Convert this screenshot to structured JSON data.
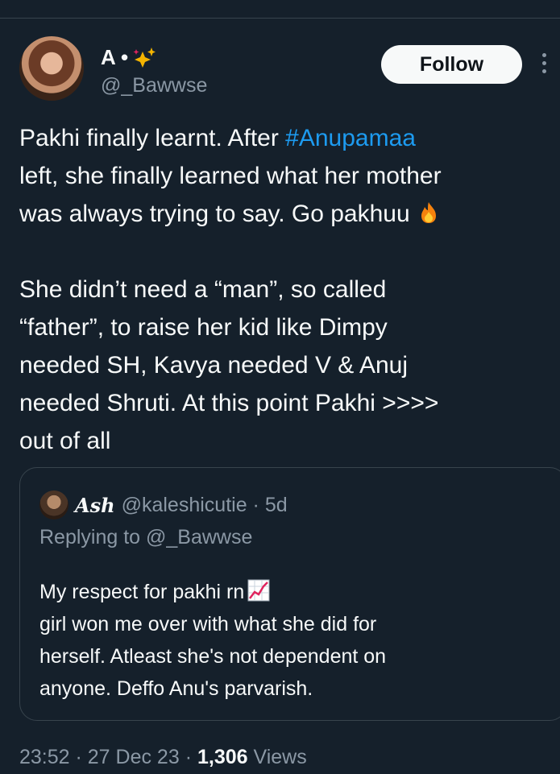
{
  "author": {
    "display_name": "A •",
    "handle": "@_Bawwse"
  },
  "follow_label": "Follow",
  "tweet": {
    "line1_before": "Pakhi finally learnt. After ",
    "hashtag": "#Anupamaa",
    "line2": "left, she finally learned what her mother",
    "line3": "was always trying to say. Go pakhuu ",
    "para2_l1": "She didn’t need a “man”, so called",
    "para2_l2": "“father”, to raise her kid like Dimpy",
    "para2_l3": "needed SH, Kavya needed V & Anuj",
    "para2_l4": "needed Shruti. At this point Pakhi >>>>",
    "para2_l5": "out of all"
  },
  "quote": {
    "name": "Ash",
    "handle_time": "@kaleshicutie · 5d",
    "replying_to": "Replying to @_Bawwse",
    "l1": "My respect for pakhi rn",
    "l2": "girl won me over with what she did for",
    "l3": "herself. Atleast she's not dependent on",
    "l4": "anyone. Deffo Anu's parvarish."
  },
  "meta": {
    "time_date": "23:52 · 27 Dec 23 · ",
    "views_count": "1,306",
    "views_label": " Views"
  },
  "icons": [
    "sparkles-icon",
    "fire-icon",
    "chart-increasing-icon",
    "more-options-icon"
  ],
  "colors": {
    "background": "#15202b",
    "link": "#1d9bf0",
    "muted": "#8b98a5",
    "text": "#f7f9f9"
  }
}
